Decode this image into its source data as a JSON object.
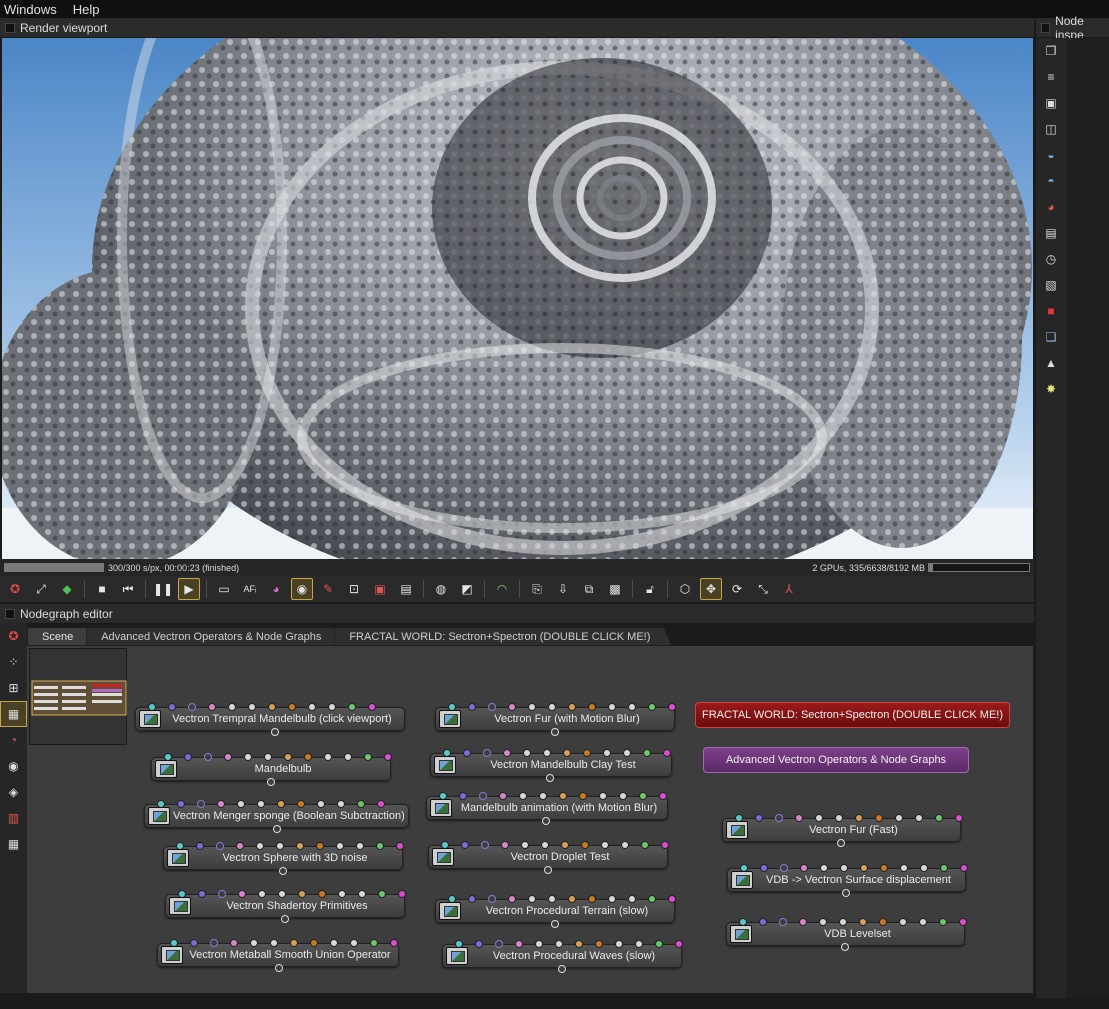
{
  "menubar": {
    "items": [
      "Windows",
      "Help"
    ]
  },
  "render_viewport": {
    "title": "Render viewport"
  },
  "node_inspector": {
    "title": "Node inspe"
  },
  "status": {
    "left_text": "300/300 s/px, 00:00:23 (finished)",
    "right_text": "2 GPUs, 335/6638/8192 MB",
    "render_progress": 1.0,
    "memory_progress": 0.04
  },
  "nodegraph": {
    "title": "Nodegraph editor",
    "tabs": [
      {
        "label": "Scene",
        "active": true
      },
      {
        "label": "Advanced  Vectron  Operators & Node Graphs",
        "active": false
      },
      {
        "label": "FRACTAL WORLD:  Sectron+Spectron (DOUBLE CLICK ME!)",
        "active": false
      }
    ],
    "nodes": [
      "Vectron Trempral Mandelbulb (click viewport)",
      "Mandelbulb",
      "Vectron Menger sponge (Boolean Subctraction)",
      "Vectron Sphere with 3D noise",
      "Vectron Shadertoy Primitives",
      "Vectron Metaball Smooth Union Operator",
      "Vectron Fur (with Motion Blur)",
      "Vectron Mandelbulb Clay Test",
      "Mandelbulb animation (with Motion Blur)",
      "Vectron Droplet Test",
      "Vectron Procedural Terrain (slow)",
      "Vectron Procedural Waves (slow)",
      "Vectron Fur (Fast)",
      "VDB -> Vectron Surface displacement",
      "VDB Levelset"
    ],
    "macros": [
      {
        "label": "FRACTAL WORLD:  Sectron+Spectron (DOUBLE CLICK ME!)",
        "color": "#8e1414"
      },
      {
        "label": "Advanced  Vectron  Operators & Node Graphs",
        "color": "#6f378a"
      }
    ],
    "pin_colors": [
      "#5cc9c9",
      "#7d6ad6",
      "#3d3d3d",
      "#d986c8",
      "#d8d8d8",
      "#d8d8d8",
      "#d6a05c",
      "#c87a22",
      "#d8d8d8",
      "#d8d8d8",
      "#6cc76c",
      "#d94fd0"
    ]
  },
  "colors": {
    "accent": "#c7a54a",
    "sky": "#6aa2d8",
    "fractal": "#b9bcc2"
  }
}
